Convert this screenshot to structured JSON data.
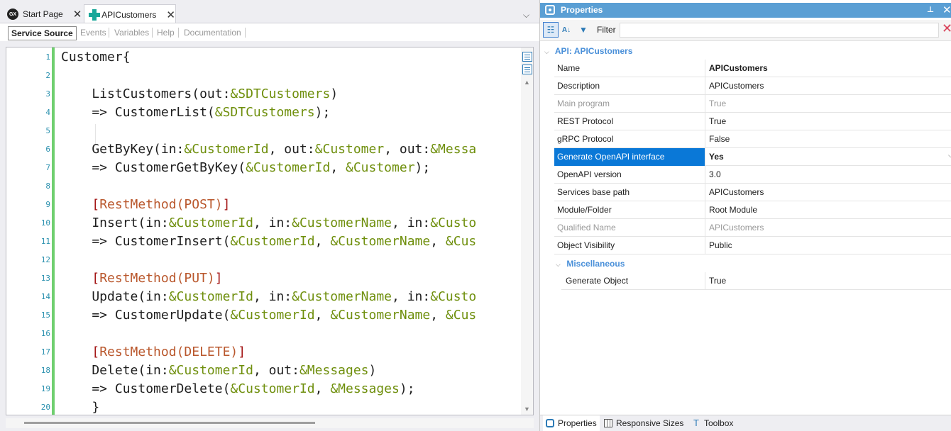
{
  "tabs": [
    {
      "label": "Start Page",
      "icon": "gx-logo-icon",
      "active": false
    },
    {
      "label": "APICustomers",
      "icon": "api-object-icon",
      "active": true
    }
  ],
  "subtabs": [
    "Service Source",
    "Events",
    "Variables",
    "Help",
    "Documentation"
  ],
  "code": {
    "line_numbers": [
      "1",
      "2",
      "3",
      "4",
      "5",
      "6",
      "7",
      "8",
      "9",
      "10",
      "11",
      "12",
      "13",
      "14",
      "15",
      "16",
      "17",
      "18",
      "19",
      "20"
    ],
    "lines": [
      [
        {
          "t": "Customer{",
          "c": ""
        }
      ],
      [],
      [
        {
          "t": "    ListCustomers(out:",
          "c": ""
        },
        {
          "t": "&SDTCustomers",
          "c": "v"
        },
        {
          "t": ")",
          "c": ""
        }
      ],
      [
        {
          "t": "    => CustomerList(",
          "c": ""
        },
        {
          "t": "&SDTCustomers",
          "c": "v"
        },
        {
          "t": ");",
          "c": ""
        }
      ],
      [],
      [
        {
          "t": "    GetByKey(in:",
          "c": ""
        },
        {
          "t": "&CustomerId",
          "c": "v"
        },
        {
          "t": ", out:",
          "c": ""
        },
        {
          "t": "&Customer",
          "c": "v"
        },
        {
          "t": ", out:",
          "c": ""
        },
        {
          "t": "&Messa",
          "c": "v"
        }
      ],
      [
        {
          "t": "    => CustomerGetByKey(",
          "c": ""
        },
        {
          "t": "&CustomerId",
          "c": "v"
        },
        {
          "t": ", ",
          "c": ""
        },
        {
          "t": "&Customer",
          "c": "v"
        },
        {
          "t": ");",
          "c": ""
        }
      ],
      [],
      [
        {
          "t": "    ",
          "c": ""
        },
        {
          "t": "[",
          "c": "ak"
        },
        {
          "t": "RestMethod(POST)",
          "c": "a"
        },
        {
          "t": "]",
          "c": "ak"
        }
      ],
      [
        {
          "t": "    Insert(in:",
          "c": ""
        },
        {
          "t": "&CustomerId",
          "c": "v"
        },
        {
          "t": ", in:",
          "c": ""
        },
        {
          "t": "&CustomerName",
          "c": "v"
        },
        {
          "t": ", in:",
          "c": ""
        },
        {
          "t": "&Custo",
          "c": "v"
        }
      ],
      [
        {
          "t": "    => CustomerInsert(",
          "c": ""
        },
        {
          "t": "&CustomerId",
          "c": "v"
        },
        {
          "t": ", ",
          "c": ""
        },
        {
          "t": "&CustomerName",
          "c": "v"
        },
        {
          "t": ", ",
          "c": ""
        },
        {
          "t": "&Cus",
          "c": "v"
        }
      ],
      [],
      [
        {
          "t": "    ",
          "c": ""
        },
        {
          "t": "[",
          "c": "ak"
        },
        {
          "t": "RestMethod(PUT)",
          "c": "a"
        },
        {
          "t": "]",
          "c": "ak"
        }
      ],
      [
        {
          "t": "    Update(in:",
          "c": ""
        },
        {
          "t": "&CustomerId",
          "c": "v"
        },
        {
          "t": ", in:",
          "c": ""
        },
        {
          "t": "&CustomerName",
          "c": "v"
        },
        {
          "t": ", in:",
          "c": ""
        },
        {
          "t": "&Custo",
          "c": "v"
        }
      ],
      [
        {
          "t": "    => CustomerUpdate(",
          "c": ""
        },
        {
          "t": "&CustomerId",
          "c": "v"
        },
        {
          "t": ", ",
          "c": ""
        },
        {
          "t": "&CustomerName",
          "c": "v"
        },
        {
          "t": ", ",
          "c": ""
        },
        {
          "t": "&Cus",
          "c": "v"
        }
      ],
      [],
      [
        {
          "t": "    ",
          "c": ""
        },
        {
          "t": "[",
          "c": "ak"
        },
        {
          "t": "RestMethod(DELETE)",
          "c": "a"
        },
        {
          "t": "]",
          "c": "ak"
        }
      ],
      [
        {
          "t": "    Delete(in:",
          "c": ""
        },
        {
          "t": "&CustomerId",
          "c": "v"
        },
        {
          "t": ", out:",
          "c": ""
        },
        {
          "t": "&Messages",
          "c": "v"
        },
        {
          "t": ")",
          "c": ""
        }
      ],
      [
        {
          "t": "    => CustomerDelete(",
          "c": ""
        },
        {
          "t": "&CustomerId",
          "c": "v"
        },
        {
          "t": ", ",
          "c": ""
        },
        {
          "t": "&Messages",
          "c": "v"
        },
        {
          "t": ");",
          "c": ""
        }
      ],
      [
        {
          "t": "    }",
          "c": ""
        }
      ]
    ]
  },
  "properties": {
    "title": "Properties",
    "filter_label": "Filter",
    "filter_value": "",
    "category_main": "API: APICustomers",
    "rows": [
      {
        "name": "Name",
        "value": "APICustomers",
        "bold": true,
        "dim": false,
        "selected": false
      },
      {
        "name": "Description",
        "value": "APICustomers",
        "bold": false,
        "dim": false,
        "selected": false
      },
      {
        "name": "Main program",
        "value": "True",
        "bold": false,
        "dim": true,
        "selected": false
      },
      {
        "name": "REST Protocol",
        "value": "True",
        "bold": false,
        "dim": false,
        "selected": false
      },
      {
        "name": "gRPC Protocol",
        "value": "False",
        "bold": false,
        "dim": false,
        "selected": false
      },
      {
        "name": "Generate OpenAPI interface",
        "value": "Yes",
        "bold": true,
        "dim": false,
        "selected": true
      },
      {
        "name": "OpenAPI version",
        "value": "3.0",
        "bold": false,
        "dim": false,
        "selected": false
      },
      {
        "name": "Services base path",
        "value": "APICustomers",
        "bold": false,
        "dim": false,
        "selected": false
      },
      {
        "name": "Module/Folder",
        "value": "Root Module",
        "bold": false,
        "dim": false,
        "selected": false
      },
      {
        "name": "Qualified Name",
        "value": "APICustomers",
        "bold": false,
        "dim": true,
        "selected": false
      },
      {
        "name": "Object Visibility",
        "value": "Public",
        "bold": false,
        "dim": false,
        "selected": false
      }
    ],
    "category_misc": "Miscellaneous",
    "misc_rows": [
      {
        "name": "Generate Object",
        "value": "True"
      }
    ]
  },
  "bottom_tabs": [
    "Properties",
    "Responsive Sizes",
    "Toolbox"
  ],
  "colors": {
    "accent": "#5a9fd4",
    "selection": "#0a78d7",
    "variable": "#6f8f0d",
    "annotation": "#b9572c"
  }
}
